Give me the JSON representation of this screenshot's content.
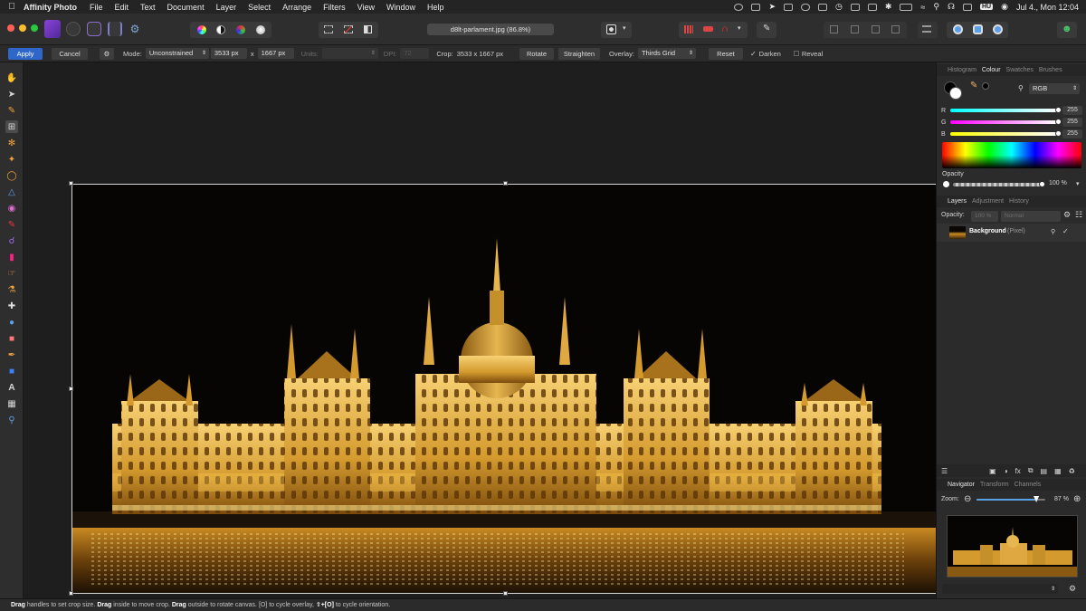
{
  "menubar": {
    "app_name": "Affinity Photo",
    "menus": [
      "File",
      "Edit",
      "Text",
      "Document",
      "Layer",
      "Select",
      "Arrange",
      "Filters",
      "View",
      "Window",
      "Help"
    ],
    "input_source": "HU",
    "clock": "Jul 4., Mon  12:04"
  },
  "document": {
    "title": "d8lt-parlament.jpg (86.8%)"
  },
  "context_bar": {
    "apply_label": "Apply",
    "cancel_label": "Cancel",
    "mode_label": "Mode:",
    "mode_value": "Unconstrained",
    "width_value": "3533 px",
    "x_label": "x",
    "height_value": "1667 px",
    "units_label": "Units:",
    "dpi_label": "DPI:",
    "dpi_value": "72",
    "crop_label": "Crop:",
    "crop_value": "3533 x 1667 px",
    "rotate_label": "Rotate",
    "straighten_label": "Straighten",
    "overlay_label": "Overlay:",
    "overlay_value": "Thirds Grid",
    "reset_label": "Reset",
    "darken_label": "Darken",
    "darken_checked": true,
    "reveal_label": "Reveal",
    "reveal_checked": false
  },
  "colour_panel": {
    "tabs": [
      "Histogram",
      "Colour",
      "Swatches",
      "Brushes"
    ],
    "active_tab": "Colour",
    "model": "RGB",
    "r_label": "R",
    "r_value": "255",
    "g_label": "G",
    "g_value": "255",
    "b_label": "B",
    "b_value": "255",
    "opacity_label": "Opacity",
    "opacity_value": "100 %",
    "opacity_level": 1.0
  },
  "layers_panel": {
    "tabs": [
      "Layers",
      "Adjustment",
      "History"
    ],
    "active_tab": "Layers",
    "opacity_label": "Opacity:",
    "opacity_value": "100 %",
    "blend_mode": "Normal",
    "layer_name": "Background",
    "layer_type": "(Pixel)"
  },
  "navigator_panel": {
    "tabs": [
      "Navigator",
      "Transform",
      "Channels"
    ],
    "active_tab": "Navigator",
    "zoom_label": "Zoom:",
    "zoom_value": "87 %",
    "zoom_level": 0.87
  },
  "status": {
    "drag1": "Drag",
    "t1": " handles to set crop size. ",
    "drag2": "Drag",
    "t2": " inside to move crop. ",
    "drag3": "Drag",
    "t3": " outside to rotate canvas. [O] to cycle overlay, ",
    "shortcut": "⇧+[O]",
    "t4": " to cycle orientation."
  },
  "colors": {
    "accent_blue": "#2f66c9",
    "gold_light": "#f2c45a",
    "gold_dark": "#8a5a12"
  }
}
